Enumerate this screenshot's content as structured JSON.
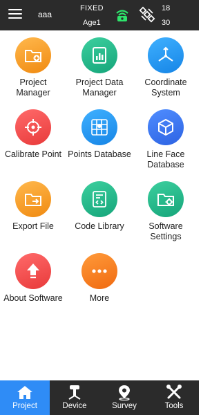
{
  "topbar": {
    "project_name": "aaa",
    "solution_status": "FIXED",
    "age_label": "Age1",
    "satellites_tracked": "18",
    "satellites_used": "30",
    "icons": [
      "menu-icon",
      "rtk-receiver-icon",
      "satellite-icon"
    ]
  },
  "tiles": [
    {
      "label": "Project\nManager",
      "icon": "folder-plus-icon",
      "color": "#f5a623"
    },
    {
      "label": "Project Data\nManager",
      "icon": "data-chart-icon",
      "color": "#1fb487"
    },
    {
      "label": "Coordinate\nSystem",
      "icon": "axes-icon",
      "color": "#2196f3"
    },
    {
      "label": "Calibrate Point",
      "icon": "crosshair-icon",
      "color": "#ef4444"
    },
    {
      "label": "Points Database",
      "icon": "map-grid-icon",
      "color": "#2196f3"
    },
    {
      "label": "Line Face\nDatabase",
      "icon": "cube-icon",
      "color": "#3a73f0"
    },
    {
      "label": "Export File",
      "icon": "folder-export-icon",
      "color": "#f5a623"
    },
    {
      "label": "Code Library",
      "icon": "code-doc-icon",
      "color": "#1fb487"
    },
    {
      "label": "Software\nSettings",
      "icon": "folder-gear-icon",
      "color": "#1fb487"
    },
    {
      "label": "About Software",
      "icon": "upload-arrow-icon",
      "color": "#ef4444"
    },
    {
      "label": "More",
      "icon": "more-dots-icon",
      "color": "#f57c1f"
    }
  ],
  "bottom_nav": [
    {
      "label": "Project",
      "icon": "home-icon",
      "active": true
    },
    {
      "label": "Device",
      "icon": "device-icon",
      "active": false
    },
    {
      "label": "Survey",
      "icon": "survey-pin-icon",
      "active": false
    },
    {
      "label": "Tools",
      "icon": "tools-icon",
      "active": false
    }
  ]
}
